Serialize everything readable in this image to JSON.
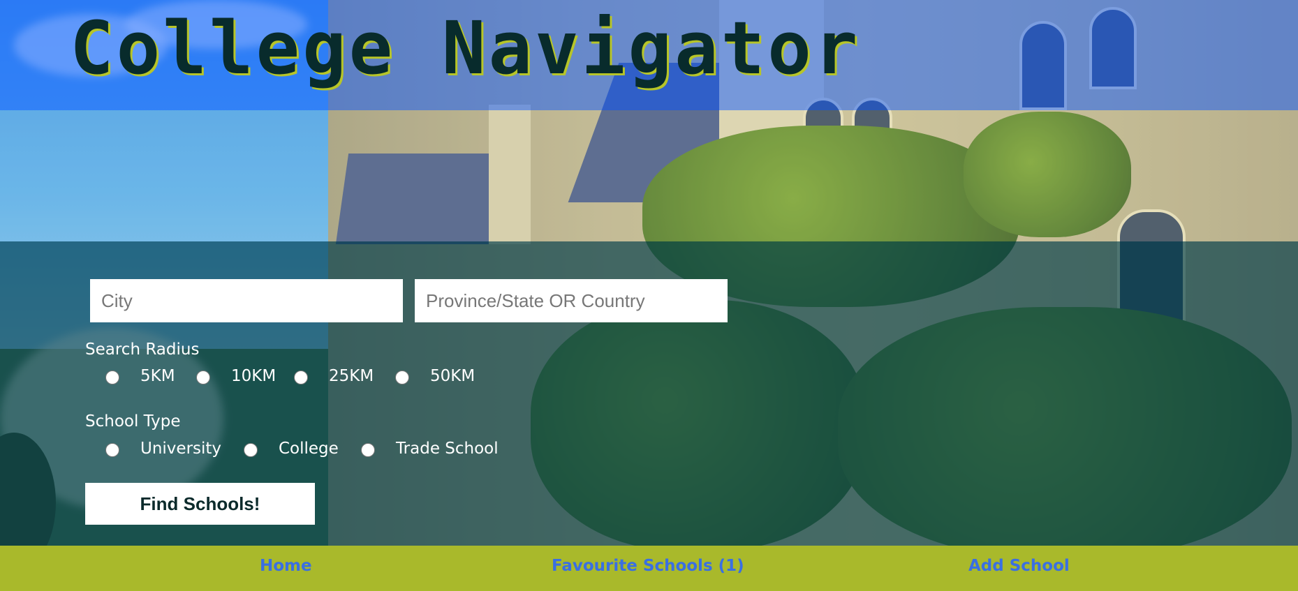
{
  "header": {
    "title": "College Navigator"
  },
  "search": {
    "city_placeholder": "City",
    "region_placeholder": "Province/State OR Country",
    "city_value": "",
    "region_value": ""
  },
  "radius": {
    "label": "Search Radius",
    "options": [
      "5KM",
      "10KM",
      "25KM",
      "50KM"
    ]
  },
  "school_type": {
    "label": "School Type",
    "options": [
      "University",
      "College",
      "Trade School"
    ]
  },
  "actions": {
    "find_label": "Find Schools!"
  },
  "nav": {
    "items": [
      "Home",
      "Favourite Schools (1)",
      "Add School"
    ],
    "link_color": "#3a6fe2",
    "bar_color": "#a9b92b"
  },
  "theme": {
    "title_color": "#082b2c",
    "title_shadow": "#b7c528",
    "form_overlay": "#0a4650"
  }
}
